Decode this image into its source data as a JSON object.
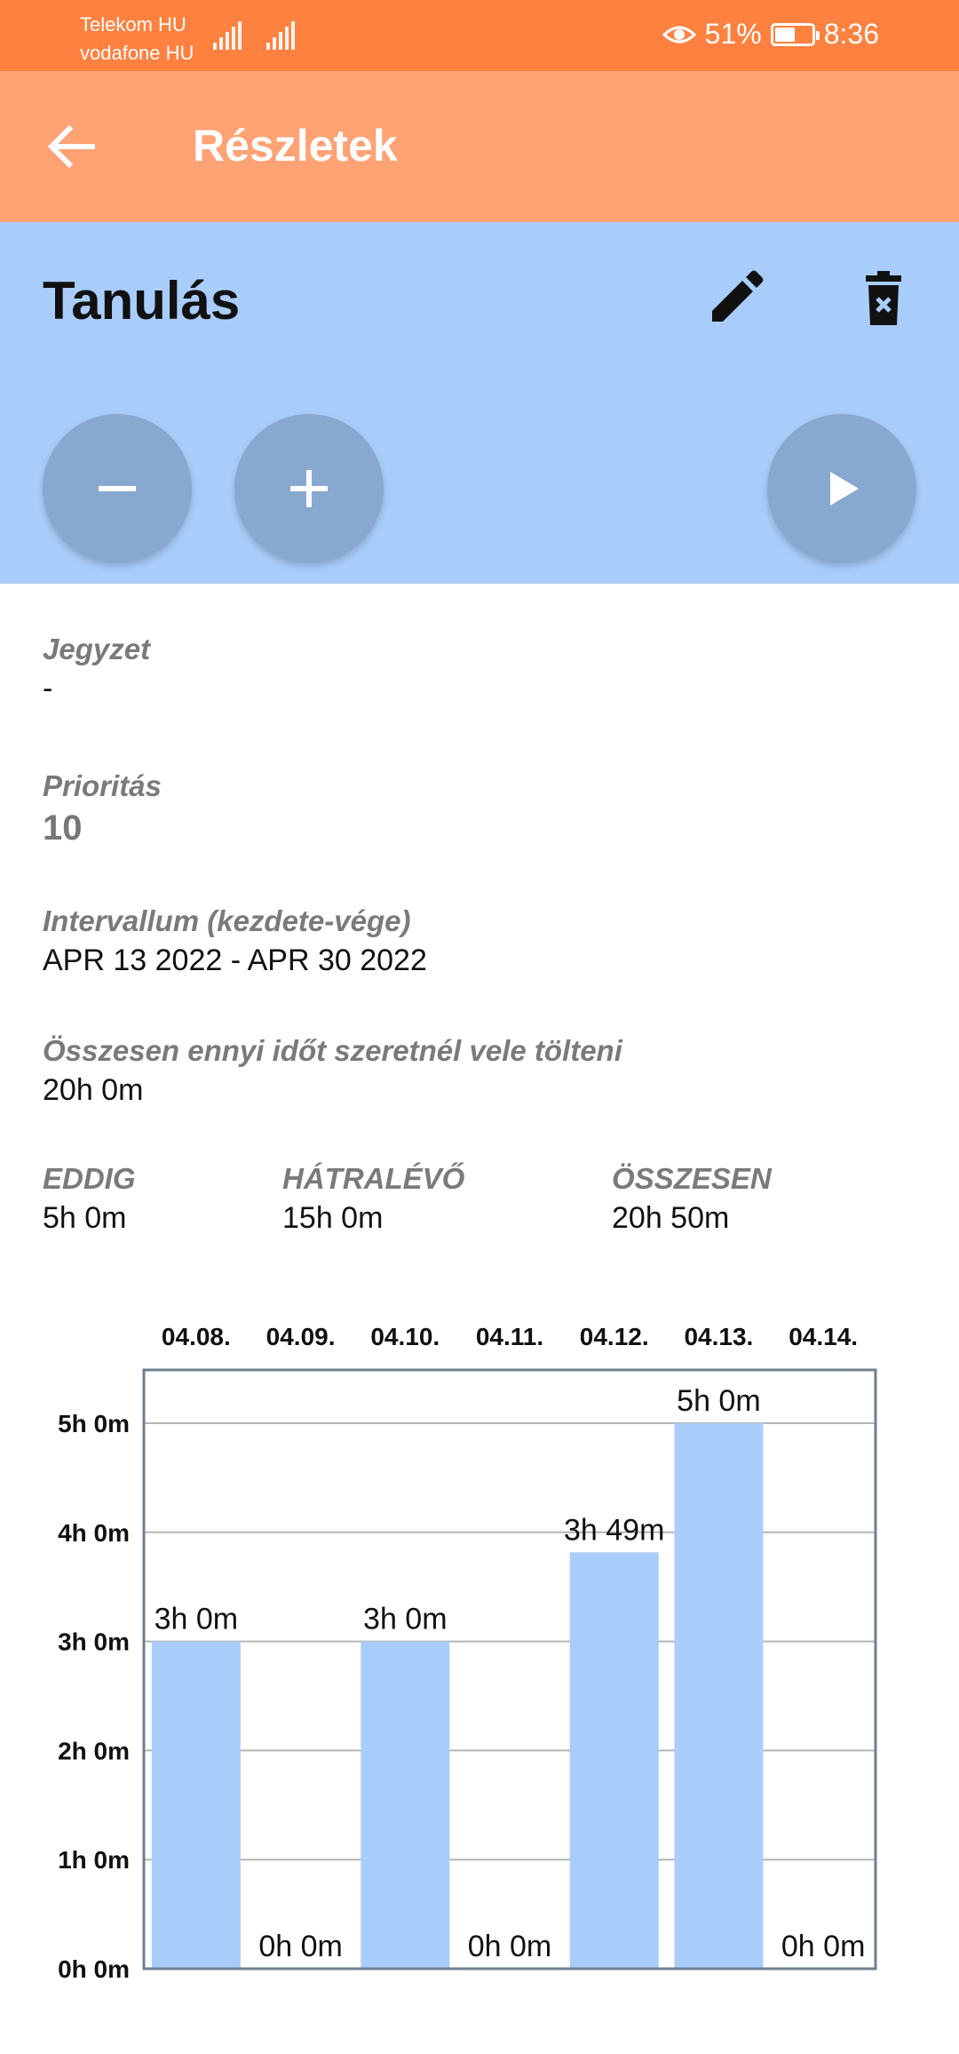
{
  "status": {
    "carrier1": "Telekom HU",
    "carrier2": "vodafone HU",
    "battery": "51%",
    "time": "8:36"
  },
  "appbar": {
    "title": "Részletek",
    "back_icon": "arrow-left-icon"
  },
  "task": {
    "title": "Tanulás",
    "edit_icon": "pencil-icon",
    "delete_icon": "trash-icon",
    "actions": [
      "minus-icon",
      "plus-icon",
      "play-icon"
    ]
  },
  "details": {
    "note_label": "Jegyzet",
    "note_value": "-",
    "priority_label": "Prioritás",
    "priority_value": "10",
    "interval_label": "Intervallum (kezdete-vége)",
    "interval_value": "APR 13 2022 - APR 30 2022",
    "goal_label": "Összesen ennyi időt szeretnél vele tölteni",
    "goal_value": "20h 0m",
    "done_label": "EDDIG",
    "done_value": "5h 0m",
    "left_label": "HÁTRALÉVŐ",
    "left_value": "15h 0m",
    "total_label": "ÖSSZESEN",
    "total_value": "20h 50m"
  },
  "colors": {
    "statusbar": "#ff8140",
    "appbar": "#ffa274",
    "header": "#a9cdfb",
    "fab": "#87a8cf",
    "bar": "#a9cdfb"
  },
  "chart_data": {
    "type": "bar",
    "categories": [
      "04.08.",
      "04.09.",
      "04.10.",
      "04.11.",
      "04.12.",
      "04.13.",
      "04.14."
    ],
    "values_minutes": [
      180,
      0,
      180,
      0,
      229,
      300,
      0
    ],
    "data_labels": [
      "3h 0m",
      "0h 0m",
      "3h 0m",
      "0h 0m",
      "3h 49m",
      "5h 0m",
      "0h 0m"
    ],
    "y_ticks": [
      "0h 0m",
      "1h 0m",
      "2h 0m",
      "3h 0m",
      "4h 0m",
      "5h 0m"
    ],
    "ylim": [
      0,
      300
    ],
    "grid": true
  }
}
